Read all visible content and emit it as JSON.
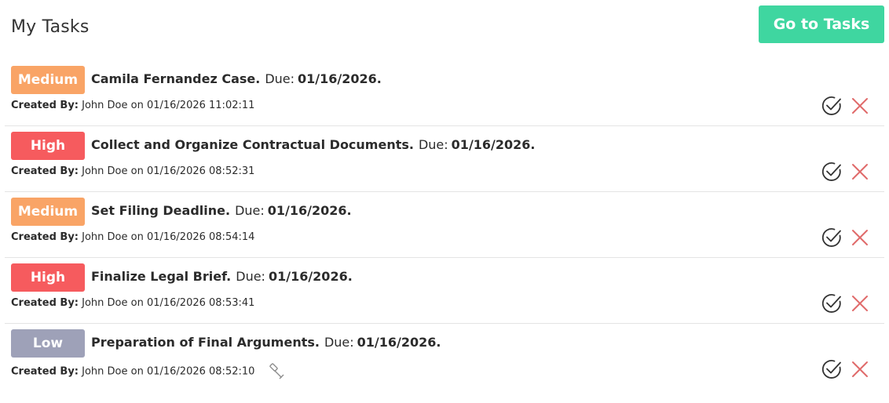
{
  "header": {
    "title": "My Tasks",
    "go_button_label": "Go to Tasks"
  },
  "colors": {
    "medium": "#f9a466",
    "high": "#f65b5e",
    "low": "#9ea1b8",
    "accent": "#3fd6a0",
    "close": "#e06a6a"
  },
  "labels": {
    "due": "Due:",
    "created_by": "Created By:"
  },
  "tasks": [
    {
      "priority": "Medium",
      "title": "Camila Fernandez Case.",
      "due_date": "01/16/2026.",
      "created_text": "John Doe on 01/16/2026 11:02:11",
      "has_gavel_icon": false
    },
    {
      "priority": "High",
      "title": "Collect and Organize Contractual Documents.",
      "due_date": "01/16/2026.",
      "created_text": "John Doe on 01/16/2026 08:52:31",
      "has_gavel_icon": false
    },
    {
      "priority": "Medium",
      "title": "Set Filing Deadline.",
      "due_date": "01/16/2026.",
      "created_text": "John Doe on 01/16/2026 08:54:14",
      "has_gavel_icon": false
    },
    {
      "priority": "High",
      "title": "Finalize Legal Brief.",
      "due_date": "01/16/2026.",
      "created_text": "John Doe on 01/16/2026 08:53:41",
      "has_gavel_icon": false
    },
    {
      "priority": "Low",
      "title": "Preparation of Final Arguments.",
      "due_date": "01/16/2026.",
      "created_text": "John Doe on 01/16/2026 08:52:10",
      "has_gavel_icon": true
    }
  ]
}
